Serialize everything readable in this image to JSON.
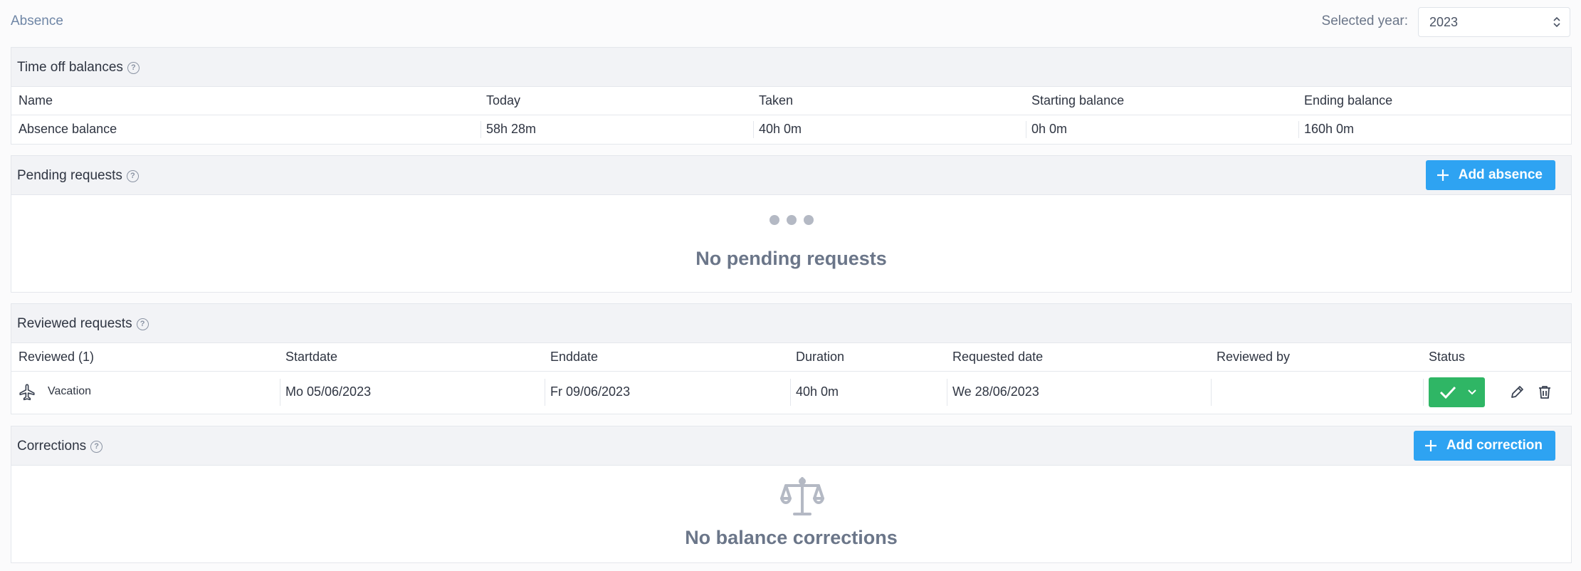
{
  "header": {
    "breadcrumb": "Absence",
    "year_label": "Selected year:",
    "year_value": "2023"
  },
  "balances": {
    "title": "Time off balances",
    "columns": [
      "Name",
      "Today",
      "Taken",
      "Starting balance",
      "Ending balance"
    ],
    "row": [
      "Absence balance",
      "58h 28m",
      "40h 0m",
      "0h 0m",
      "160h 0m"
    ]
  },
  "pending": {
    "title": "Pending requests",
    "add_label": "Add absence",
    "empty_text": "No pending requests"
  },
  "reviewed": {
    "title": "Reviewed requests",
    "columns": [
      "Reviewed (1)",
      "Startdate",
      "Enddate",
      "Duration",
      "Requested date",
      "Reviewed by",
      "Status"
    ],
    "row": {
      "type": "Vacation",
      "start": "Mo 05/06/2023",
      "end": "Fr 09/06/2023",
      "duration": "40h 0m",
      "requested": "We 28/06/2023",
      "reviewed_by": ""
    }
  },
  "corrections": {
    "title": "Corrections",
    "add_label": "Add correction",
    "empty_text": "No balance corrections"
  },
  "colors": {
    "accent_blue": "#2ea3f2",
    "status_green": "#2fb665"
  }
}
